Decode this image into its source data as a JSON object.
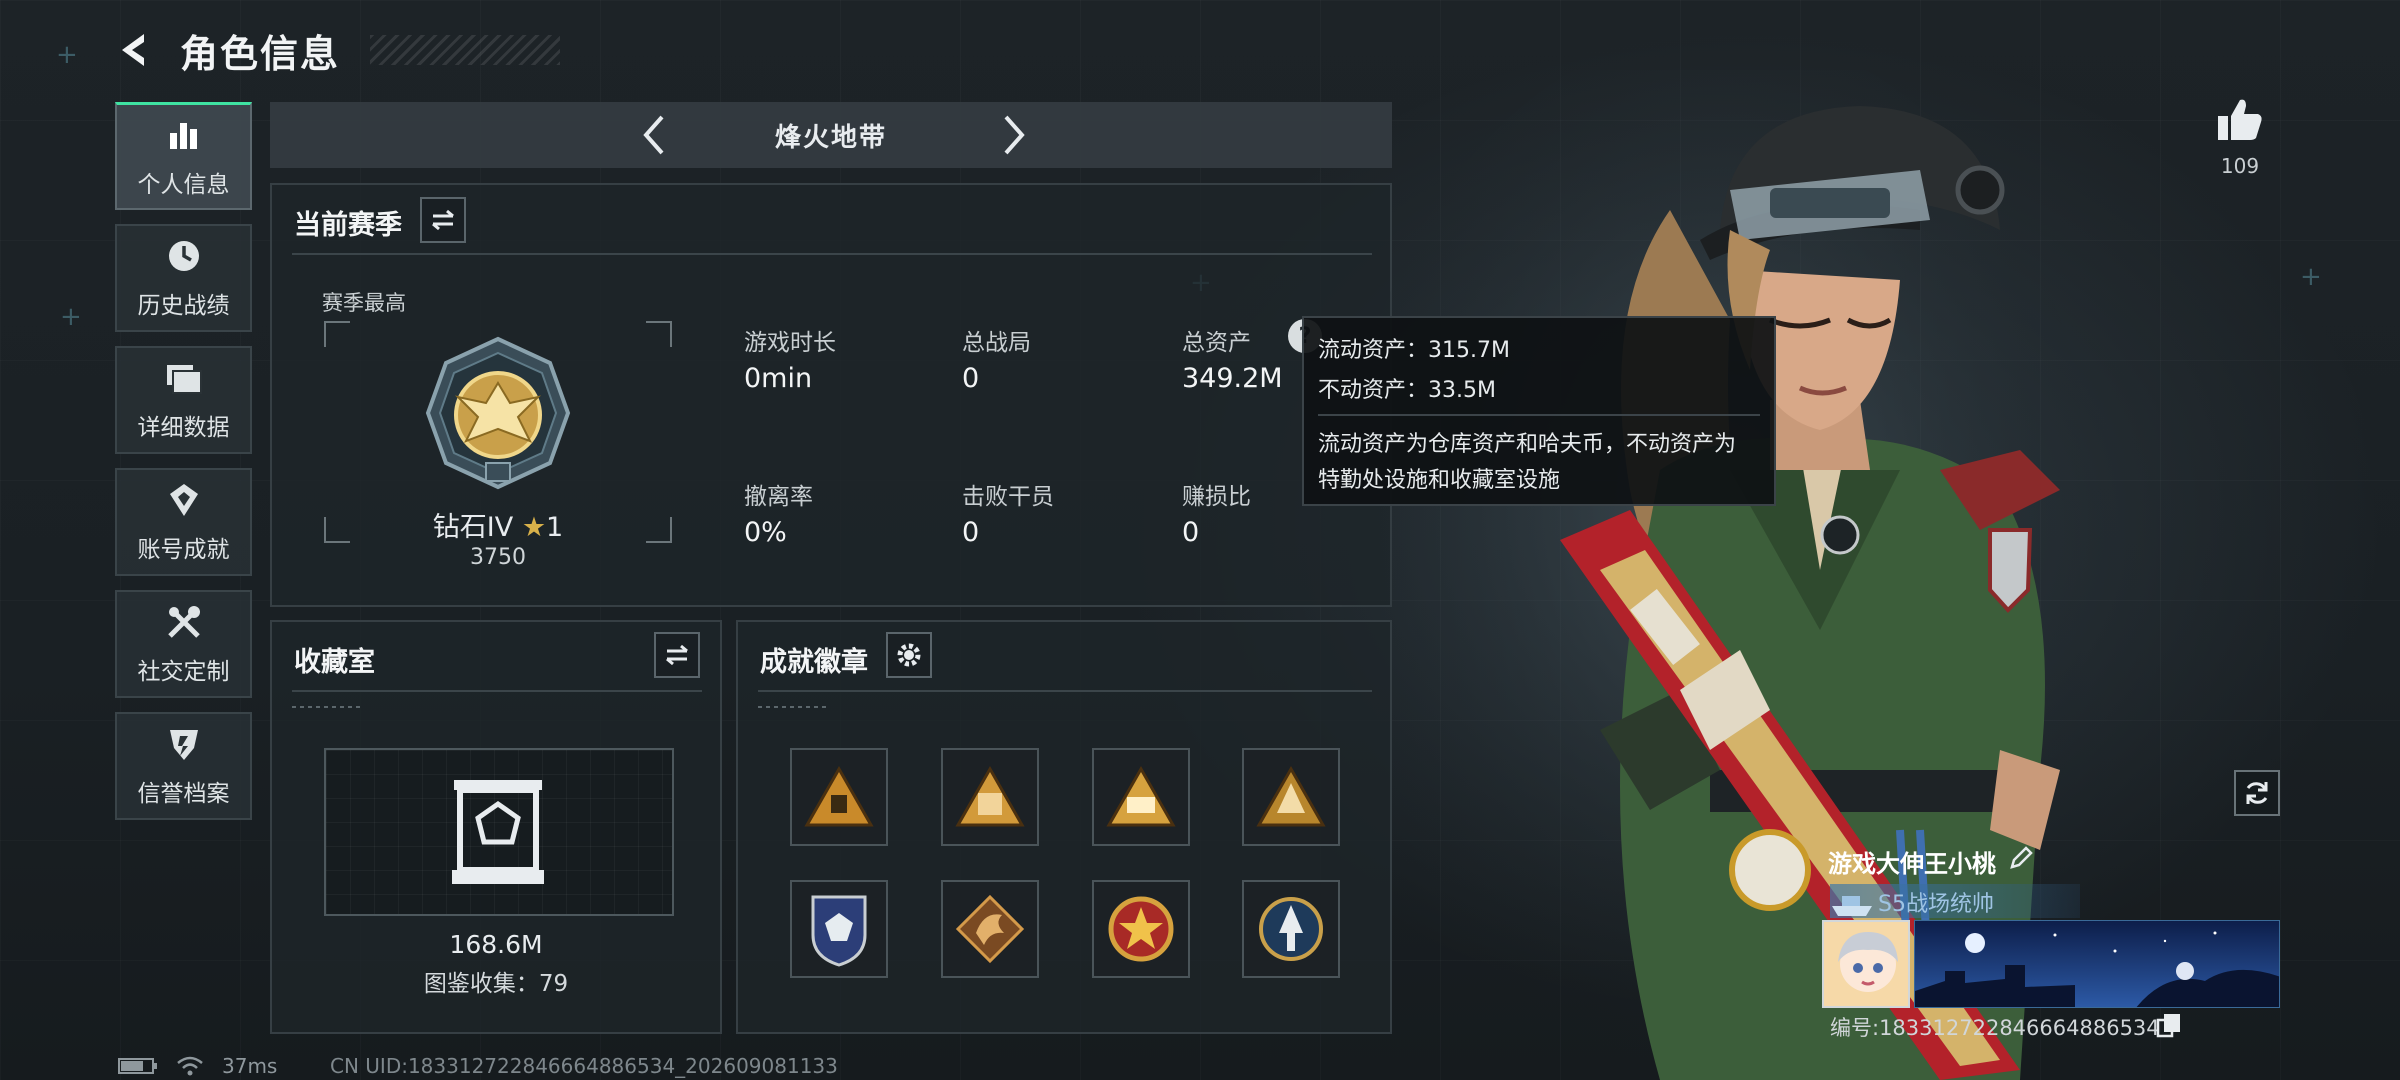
{
  "header": {
    "title": "角色信息",
    "back_icon": "back-arrow-icon"
  },
  "nav": {
    "items": [
      {
        "label": "个人信息",
        "icon": "bar-chart-icon",
        "active": true
      },
      {
        "label": "历史战绩",
        "icon": "clock-icon",
        "active": false
      },
      {
        "label": "详细数据",
        "icon": "folder-icon",
        "active": false
      },
      {
        "label": "账号成就",
        "icon": "trophy-icon",
        "active": false
      },
      {
        "label": "社交定制",
        "icon": "tools-icon",
        "active": false
      },
      {
        "label": "信誉档案",
        "icon": "shield-icon",
        "active": false
      }
    ]
  },
  "mode": {
    "title": "烽火地带"
  },
  "season": {
    "title": "当前赛季",
    "best_label": "赛季最高",
    "rank_name": "钻石IV",
    "rank_stars": "1",
    "rank_score": "3750",
    "stats": [
      {
        "label": "游戏时长",
        "value": "0min"
      },
      {
        "label": "总战局",
        "value": "0"
      },
      {
        "label": "总资产",
        "value": "349.2M"
      },
      {
        "label": "撤离率",
        "value": "0%"
      },
      {
        "label": "击败干员",
        "value": "0"
      },
      {
        "label": "赚损比",
        "value": "0"
      }
    ]
  },
  "tooltip": {
    "liquid": "流动资产：315.7M",
    "fixed": "不动资产：33.5M",
    "desc_line1": "流动资产为仓库资产和哈夫币，不动资产为",
    "desc_line2": "特勤处设施和收藏室设施"
  },
  "collection": {
    "title": "收藏室",
    "value": "168.6M",
    "count": "图鉴收集：79"
  },
  "achievements": {
    "title": "成就徽章",
    "badges": [
      "pyramid-badge-1",
      "pyramid-badge-2",
      "pyramid-badge-3",
      "pyramid-badge-4",
      "shield-badge",
      "dragon-badge",
      "star-badge",
      "arrow-badge"
    ]
  },
  "profile": {
    "likes": "109",
    "player_name": "游戏大伸王小桃",
    "player_title": "S5战场统帅",
    "player_id": "编号:1833127228466648865​34"
  },
  "footer": {
    "ping": "37ms",
    "uid": "CN UID:18331272284666488​6534_202609081133"
  },
  "colors": {
    "accent": "#3fe3a2",
    "panel": "#1e2529",
    "gold": "#c9a04a",
    "uniform": "#3c5e3a",
    "rifle_red": "#b3222a"
  }
}
